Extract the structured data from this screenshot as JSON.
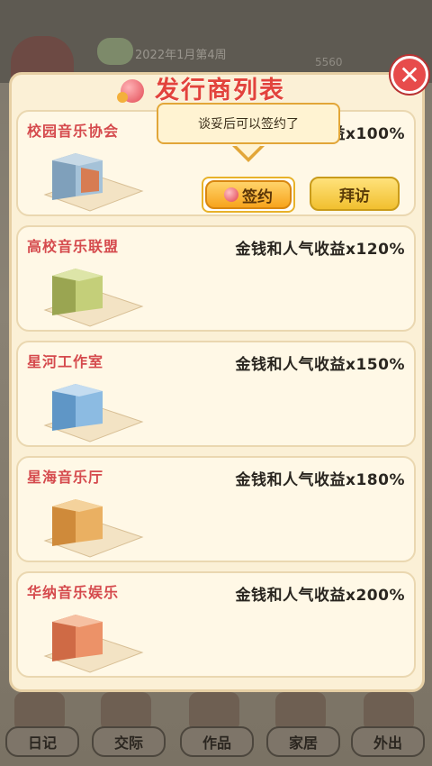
{
  "background": {
    "date": "2022年1月第4周",
    "money": "5560"
  },
  "panel": {
    "title": "发行商列表",
    "close_symbol": "✕"
  },
  "tooltip": {
    "text": "谈妥后可以签约了"
  },
  "publishers": [
    {
      "name": "校园音乐协会",
      "bonus": "金钱和人气收益x100%",
      "building_color": "#8fb0c8"
    },
    {
      "name": "高校音乐联盟",
      "bonus": "金钱和人气收益x120%",
      "building_color": "#b6c46a"
    },
    {
      "name": "星河工作室",
      "bonus": "金钱和人气收益x150%",
      "building_color": "#7fb4de"
    },
    {
      "name": "星海音乐厅",
      "bonus": "金钱和人气收益x180%",
      "building_color": "#e6a451"
    },
    {
      "name": "华纳音乐娱乐",
      "bonus": "金钱和人气收益x200%",
      "building_color": "#e58a5a"
    }
  ],
  "actions": {
    "sign": "签约",
    "visit": "拜访"
  },
  "bottom_nav": [
    {
      "label": "日记",
      "icon": "diary-icon"
    },
    {
      "label": "交际",
      "icon": "social-icon"
    },
    {
      "label": "作品",
      "icon": "works-icon"
    },
    {
      "label": "家居",
      "icon": "home-icon"
    },
    {
      "label": "外出",
      "icon": "outing-icon"
    }
  ]
}
